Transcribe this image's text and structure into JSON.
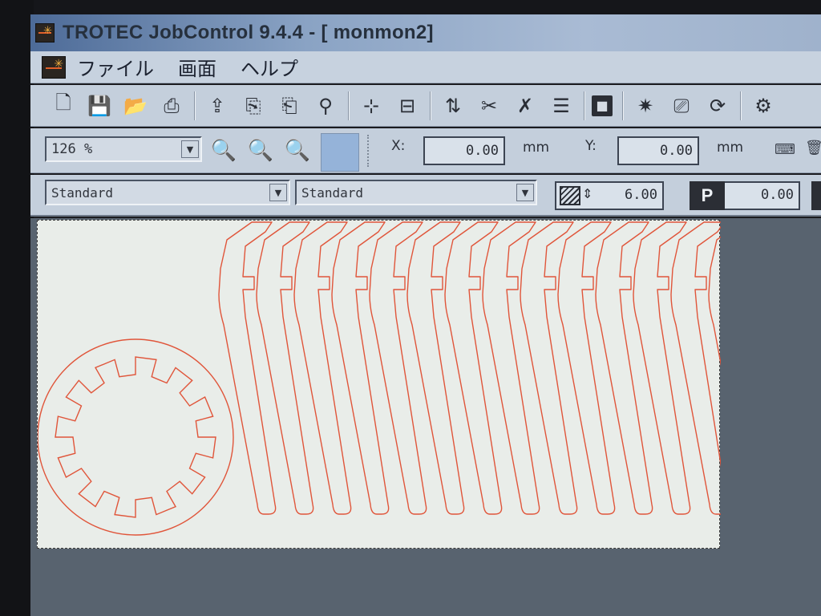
{
  "window": {
    "title": "TROTEC JobControl 9.4.4 - [ monmon2]"
  },
  "menubar": {
    "items": [
      {
        "name": "file",
        "label": "ファイル"
      },
      {
        "name": "view",
        "label": "画面"
      },
      {
        "name": "help",
        "label": "ヘルプ"
      }
    ]
  },
  "toolbar": {
    "icons": [
      "new-file-icon",
      "save-icon",
      "open-folder-icon",
      "print-icon",
      "import-icon",
      "import-job-icon",
      "export-job-icon",
      "job-settings-icon",
      "add-node-icon",
      "remove-node-icon",
      "align-icon",
      "cut-icon",
      "delete-icon",
      "list-icon",
      "stop-icon",
      "laser-icon",
      "material-icon",
      "process-icon",
      "settings-gear-icon"
    ]
  },
  "zoom": {
    "value": "126 %"
  },
  "position": {
    "x_label": "X:",
    "x_value": "0.00",
    "x_unit": "mm",
    "y_label": "Y:",
    "y_value": "0.00",
    "y_unit": "mm"
  },
  "material": {
    "template": "Standard",
    "process": "Standard"
  },
  "thickness": {
    "value": "6.00"
  },
  "power": {
    "label": "P",
    "value": "0.00"
  },
  "colors": {
    "cut_line": "#e0553a",
    "canvas": "#e9ede9",
    "color_swatch": "#95b3d9",
    "workspace": "#58636f"
  },
  "job": {
    "part_count": 14,
    "gear_tooth_count": 12
  }
}
